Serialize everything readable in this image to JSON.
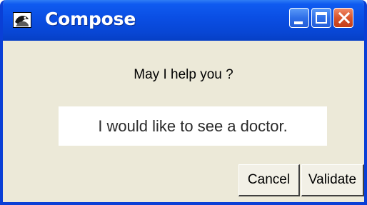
{
  "window": {
    "title": "Compose",
    "icons": {
      "app": "compose-app-icon",
      "minimize": "minimize-icon",
      "maximize": "maximize-icon",
      "close": "close-icon"
    },
    "colors": {
      "titlebar": "#0a4ee3",
      "body": "#ece9d8",
      "close_button": "#d8542c"
    }
  },
  "dialog": {
    "prompt": "May I help you ?",
    "answer_value": "I would like to see a doctor."
  },
  "buttons": {
    "cancel_label": "Cancel",
    "validate_label": "Validate"
  }
}
